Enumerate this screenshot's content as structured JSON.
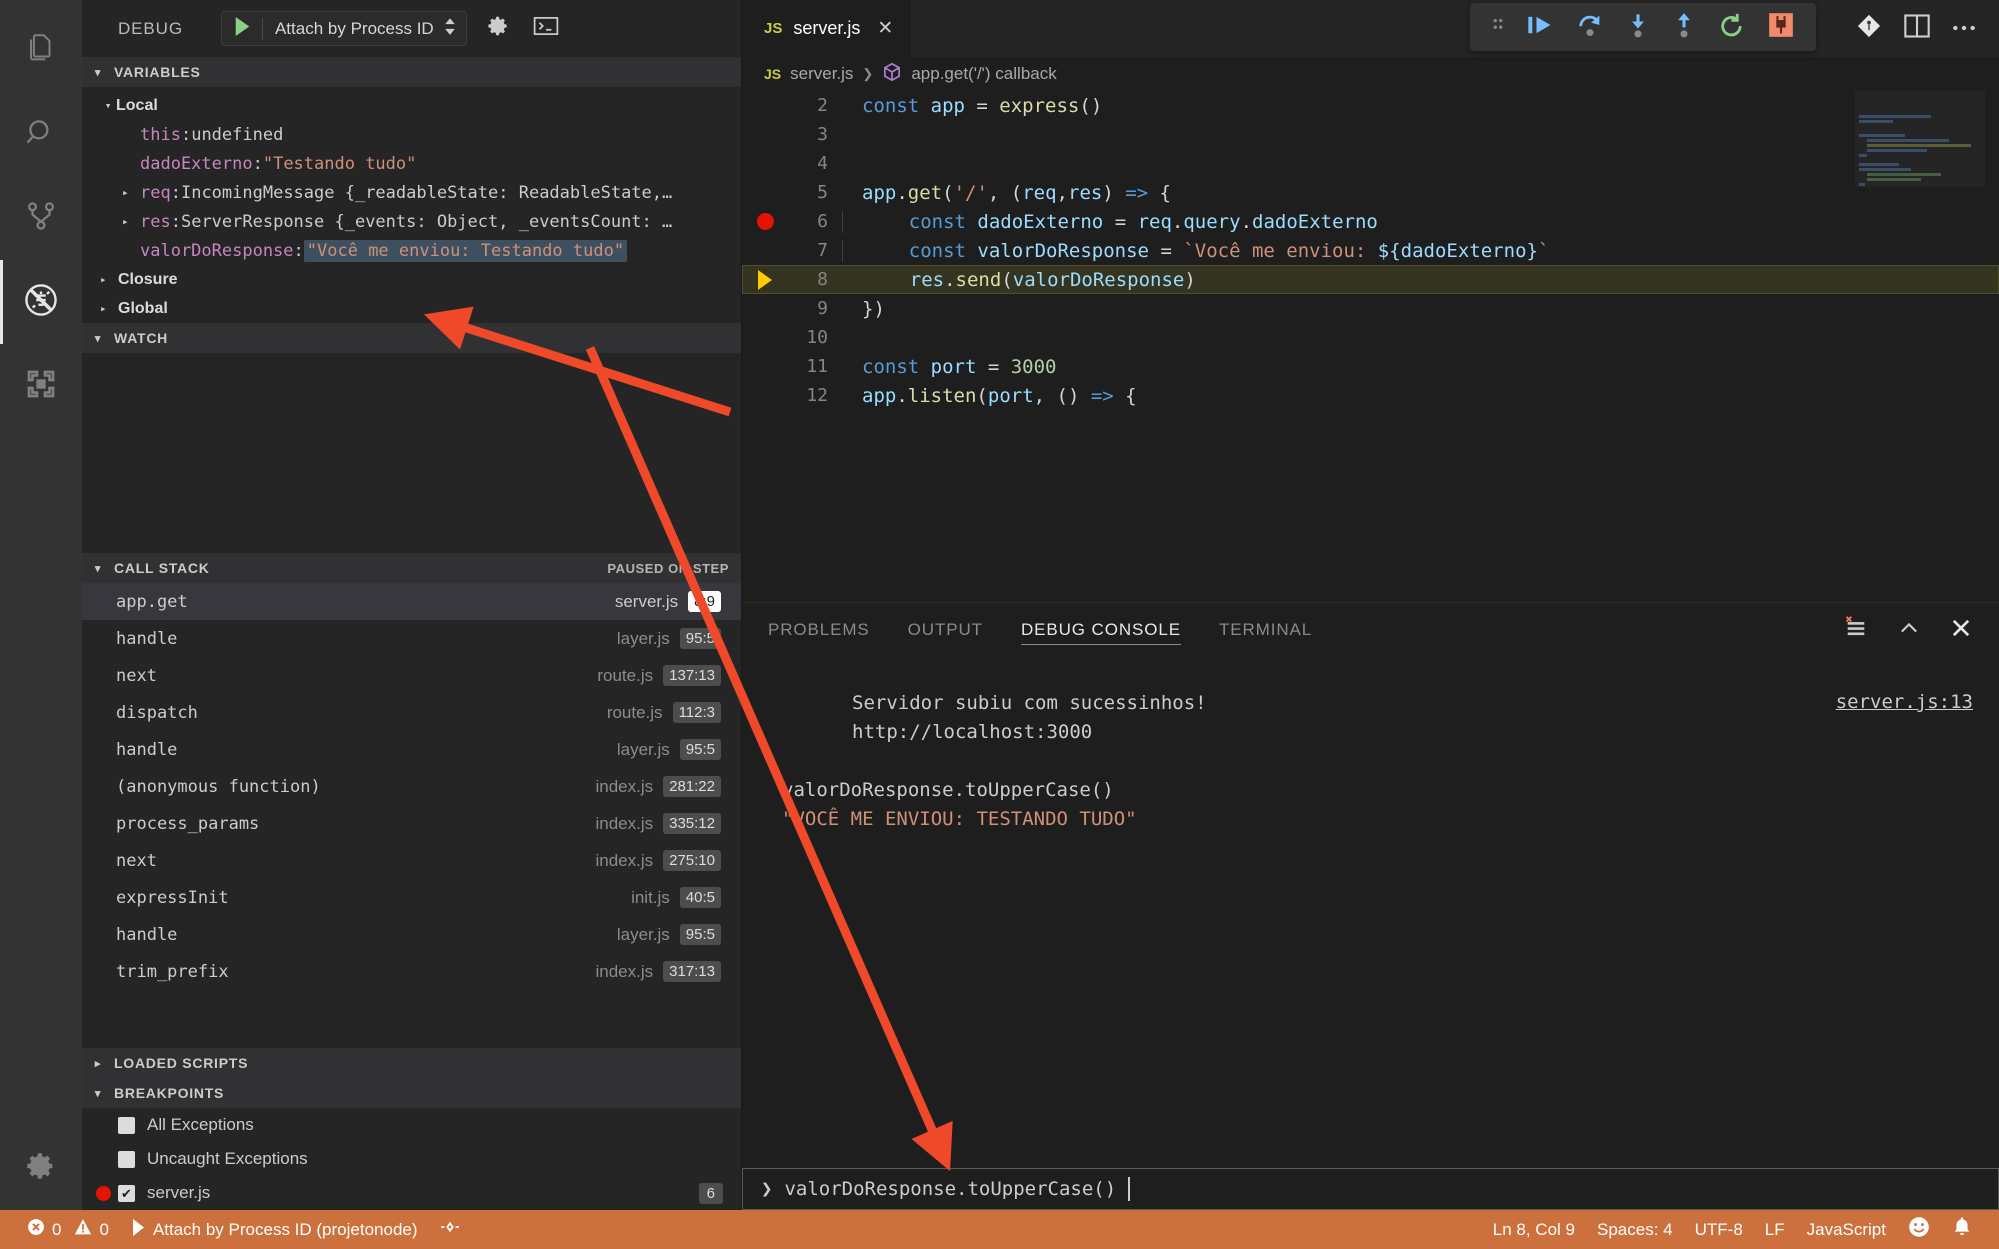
{
  "activitybar": {
    "items": [
      {
        "name": "explorer",
        "icon": "files-icon"
      },
      {
        "name": "search",
        "icon": "search-icon"
      },
      {
        "name": "source-control",
        "icon": "source-control-icon"
      },
      {
        "name": "run-and-debug",
        "icon": "debug-alt-icon",
        "active": true
      },
      {
        "name": "extensions",
        "icon": "extensions-icon"
      }
    ],
    "manage": {
      "icon": "gear-icon"
    }
  },
  "sidebar": {
    "title": "DEBUG",
    "launch_config": "Attach by Process ID",
    "start_icon": "play-icon",
    "dropdown_icon": "chevron-updown-icon",
    "settings_icon": "gear-icon",
    "open_console_icon": "terminal-icon",
    "sections": {
      "variables": {
        "label": "VARIABLES",
        "scope_local": "Local",
        "rows": [
          {
            "name": "this",
            "sep": ": ",
            "value": "undefined",
            "kind": "plain",
            "expandable": false
          },
          {
            "name": "dadoExterno",
            "sep": ": ",
            "value": "\"Testando tudo\"",
            "kind": "string",
            "expandable": false
          },
          {
            "name": "req",
            "sep": ": ",
            "value": "IncomingMessage {_readableState: ReadableState,…",
            "kind": "plain",
            "expandable": true
          },
          {
            "name": "res",
            "sep": ": ",
            "value": "ServerResponse {_events: Object, _eventsCount: …",
            "kind": "plain",
            "expandable": true
          },
          {
            "name": "valorDoResponse",
            "sep": ": ",
            "value": "\"Você me enviou: Testando tudo\"",
            "kind": "string",
            "expandable": false,
            "highlighted": true
          }
        ],
        "scope_closure": "Closure",
        "scope_global": "Global"
      },
      "watch": {
        "label": "WATCH"
      },
      "callstack": {
        "label": "CALL STACK",
        "status": "PAUSED ON STEP",
        "frames": [
          {
            "fn": "app.get",
            "file": "server.js",
            "pos": "8:9",
            "selected": true
          },
          {
            "fn": "handle",
            "file": "layer.js",
            "pos": "95:5",
            "selected": false
          },
          {
            "fn": "next",
            "file": "route.js",
            "pos": "137:13",
            "selected": false
          },
          {
            "fn": "dispatch",
            "file": "route.js",
            "pos": "112:3",
            "selected": false
          },
          {
            "fn": "handle",
            "file": "layer.js",
            "pos": "95:5",
            "selected": false
          },
          {
            "fn": "(anonymous function)",
            "file": "index.js",
            "pos": "281:22",
            "selected": false
          },
          {
            "fn": "process_params",
            "file": "index.js",
            "pos": "335:12",
            "selected": false
          },
          {
            "fn": "next",
            "file": "index.js",
            "pos": "275:10",
            "selected": false
          },
          {
            "fn": "expressInit",
            "file": "init.js",
            "pos": "40:5",
            "selected": false
          },
          {
            "fn": "handle",
            "file": "layer.js",
            "pos": "95:5",
            "selected": false
          },
          {
            "fn": "trim_prefix",
            "file": "index.js",
            "pos": "317:13",
            "selected": false
          }
        ]
      },
      "loaded_scripts": {
        "label": "LOADED SCRIPTS"
      },
      "breakpoints": {
        "label": "BREAKPOINTS",
        "rows": [
          {
            "label": "All Exceptions",
            "checked": false,
            "dot": false,
            "count": ""
          },
          {
            "label": "Uncaught Exceptions",
            "checked": false,
            "dot": false,
            "count": ""
          },
          {
            "label": "server.js",
            "checked": true,
            "dot": true,
            "count": "6"
          }
        ]
      }
    }
  },
  "editor": {
    "tab": {
      "label": "server.js",
      "badge": "JS",
      "close": "✕"
    },
    "tab_actions": {
      "source_control_icon": "source-control-icon",
      "split_icon": "split-editor-icon",
      "more_icon": "more-actions-icon"
    },
    "breadcrumb": {
      "badge": "JS",
      "file": "server.js",
      "symbol": "app.get('/') callback",
      "separator": "❯"
    },
    "debug_toolbar": {
      "drag_handle": "gripper-icon",
      "buttons": [
        {
          "name": "continue",
          "icon": "continue-icon"
        },
        {
          "name": "step-over",
          "icon": "step-over-icon"
        },
        {
          "name": "step-into",
          "icon": "step-into-icon"
        },
        {
          "name": "step-out",
          "icon": "step-out-icon"
        },
        {
          "name": "restart",
          "icon": "restart-icon"
        },
        {
          "name": "disconnect",
          "icon": "disconnect-icon"
        }
      ]
    },
    "lines": [
      {
        "n": "2",
        "indent": 0,
        "glyph": "",
        "tokens": [
          {
            "t": "const ",
            "c": "kw"
          },
          {
            "t": "app",
            "c": "vr"
          },
          {
            "t": " = ",
            "c": "op"
          },
          {
            "t": "express",
            "c": "fnc"
          },
          {
            "t": "()",
            "c": "pn"
          }
        ]
      },
      {
        "n": "3",
        "indent": 0,
        "glyph": "",
        "tokens": []
      },
      {
        "n": "4",
        "indent": 0,
        "glyph": "",
        "tokens": []
      },
      {
        "n": "5",
        "indent": 0,
        "glyph": "",
        "tokens": [
          {
            "t": "app",
            "c": "vr"
          },
          {
            "t": ".",
            "c": "pn"
          },
          {
            "t": "get",
            "c": "fnc"
          },
          {
            "t": "(",
            "c": "pn"
          },
          {
            "t": "'/'",
            "c": "str"
          },
          {
            "t": ", (",
            "c": "pn"
          },
          {
            "t": "req",
            "c": "vr"
          },
          {
            "t": ",",
            "c": "pn"
          },
          {
            "t": "res",
            "c": "vr"
          },
          {
            "t": ") ",
            "c": "pn"
          },
          {
            "t": "=>",
            "c": "arrw"
          },
          {
            "t": " {",
            "c": "pn"
          }
        ]
      },
      {
        "n": "6",
        "indent": 1,
        "glyph": "breakpoint",
        "tokens": [
          {
            "t": "    ",
            "c": "op"
          },
          {
            "t": "const ",
            "c": "kw"
          },
          {
            "t": "dadoExterno",
            "c": "vr"
          },
          {
            "t": " = ",
            "c": "op"
          },
          {
            "t": "req",
            "c": "vr"
          },
          {
            "t": ".",
            "c": "pn"
          },
          {
            "t": "query",
            "c": "vr"
          },
          {
            "t": ".",
            "c": "pn"
          },
          {
            "t": "dadoExterno",
            "c": "vr"
          }
        ]
      },
      {
        "n": "7",
        "indent": 1,
        "glyph": "",
        "tokens": [
          {
            "t": "    ",
            "c": "op"
          },
          {
            "t": "const ",
            "c": "kw"
          },
          {
            "t": "valorDoResponse",
            "c": "vr"
          },
          {
            "t": " = ",
            "c": "op"
          },
          {
            "t": "`Você me enviou: ",
            "c": "str"
          },
          {
            "t": "${",
            "c": "vr"
          },
          {
            "t": "dadoExterno",
            "c": "vr"
          },
          {
            "t": "}",
            "c": "vr"
          },
          {
            "t": "`",
            "c": "str"
          }
        ]
      },
      {
        "n": "8",
        "indent": 1,
        "glyph": "step",
        "highlight": true,
        "tokens": [
          {
            "t": "    ",
            "c": "op"
          },
          {
            "t": "res",
            "c": "vr"
          },
          {
            "t": ".",
            "c": "pn"
          },
          {
            "t": "send",
            "c": "fnc"
          },
          {
            "t": "(",
            "c": "pn"
          },
          {
            "t": "valorDoResponse",
            "c": "vr"
          },
          {
            "t": ")",
            "c": "pn"
          }
        ]
      },
      {
        "n": "9",
        "indent": 0,
        "glyph": "",
        "tokens": [
          {
            "t": "})",
            "c": "pn"
          }
        ]
      },
      {
        "n": "10",
        "indent": 0,
        "glyph": "",
        "tokens": []
      },
      {
        "n": "11",
        "indent": 0,
        "glyph": "",
        "tokens": [
          {
            "t": "const ",
            "c": "kw"
          },
          {
            "t": "port",
            "c": "vr"
          },
          {
            "t": " = ",
            "c": "op"
          },
          {
            "t": "3000",
            "c": "num"
          }
        ]
      },
      {
        "n": "12",
        "indent": 0,
        "glyph": "",
        "tokens": [
          {
            "t": "app",
            "c": "vr"
          },
          {
            "t": ".",
            "c": "pn"
          },
          {
            "t": "listen",
            "c": "fnc"
          },
          {
            "t": "(",
            "c": "pn"
          },
          {
            "t": "port",
            "c": "vr"
          },
          {
            "t": ", () ",
            "c": "pn"
          },
          {
            "t": "=>",
            "c": "arrw"
          },
          {
            "t": " {",
            "c": "pn"
          }
        ]
      }
    ]
  },
  "panel": {
    "tabs": [
      {
        "label": "PROBLEMS",
        "active": false
      },
      {
        "label": "OUTPUT",
        "active": false
      },
      {
        "label": "DEBUG CONSOLE",
        "active": true
      },
      {
        "label": "TERMINAL",
        "active": false
      }
    ],
    "actions": [
      {
        "name": "clear-console",
        "icon": "clear-console-icon"
      },
      {
        "name": "maximize-panel",
        "icon": "chevron-up-icon"
      },
      {
        "name": "close-panel",
        "icon": "close-icon"
      }
    ],
    "source_link": "server.js:13",
    "output": [
      {
        "text": "Servidor subiu com sucessinhos!",
        "style": "out"
      },
      {
        "text": "http://localhost:3000",
        "style": "out"
      },
      {
        "text": "",
        "style": "blank"
      },
      {
        "text": "valorDoResponse.toUpperCase()",
        "style": "expr"
      },
      {
        "text": "\"VOCÊ ME ENVIOU: TESTANDO TUDO\"",
        "style": "res"
      }
    ],
    "input": {
      "prompt": "❯",
      "value": "valorDoResponse.toUpperCase()",
      "placeholder": ""
    }
  },
  "statusbar": {
    "errors_icon": "error-icon",
    "errors": "0",
    "warnings_icon": "warning-icon",
    "warnings": "0",
    "debug_run_icon": "play-icon",
    "debug_session": "Attach by Process ID (projetonode)",
    "debug_port_icon": "debug-port-icon",
    "cursor": "Ln 8, Col 9",
    "indentation": "Spaces: 4",
    "encoding": "UTF-8",
    "eol": "LF",
    "language": "JavaScript",
    "feedback_icon": "smiley-icon",
    "notifications_icon": "bell-icon",
    "background": "#cc703e"
  },
  "annotations": {
    "arrow1": "points from console expression area to valorDoResponse value in VARIABLES",
    "arrow2": "points from VARIABLES toward the debug console input"
  }
}
